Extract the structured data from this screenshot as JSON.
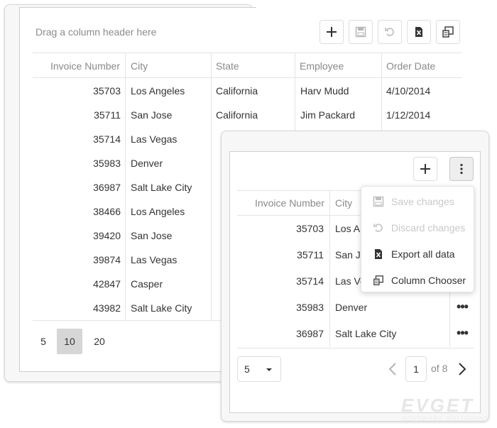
{
  "back_grid": {
    "group_panel_text": "Drag a column header here",
    "columns": [
      "Invoice Number",
      "City",
      "State",
      "Employee",
      "Order Date"
    ],
    "rows": [
      {
        "invoice": "35703",
        "city": "Los Angeles",
        "state": "California",
        "employee": "Harv Mudd",
        "date": "4/10/2014"
      },
      {
        "invoice": "35711",
        "city": "San Jose",
        "state": "California",
        "employee": "Jim Packard",
        "date": "1/12/2014"
      },
      {
        "invoice": "35714",
        "city": "Las Vegas"
      },
      {
        "invoice": "35983",
        "city": "Denver"
      },
      {
        "invoice": "36987",
        "city": "Salt Lake City"
      },
      {
        "invoice": "38466",
        "city": "Los Angeles"
      },
      {
        "invoice": "39420",
        "city": "San Jose"
      },
      {
        "invoice": "39874",
        "city": "Las Vegas"
      },
      {
        "invoice": "42847",
        "city": "Casper"
      },
      {
        "invoice": "43982",
        "city": "Salt Lake City"
      }
    ],
    "page_sizes": [
      "5",
      "10",
      "20"
    ],
    "active_page_size": "10",
    "toolbar_icons": [
      "add-icon",
      "save-icon",
      "undo-icon",
      "excel-export-icon",
      "column-chooser-icon"
    ]
  },
  "front_grid": {
    "columns": [
      "Invoice Number",
      "City"
    ],
    "rows": [
      {
        "invoice": "35703",
        "city": "Los An"
      },
      {
        "invoice": "35711",
        "city": "San Jo"
      },
      {
        "invoice": "35714",
        "city": "Las Ve"
      },
      {
        "invoice": "35983",
        "city": "Denver"
      },
      {
        "invoice": "36987",
        "city": "Salt Lake City"
      }
    ],
    "row_action_glyph": "•••",
    "toolbar_icons": [
      "add-icon",
      "more-vertical-icon"
    ],
    "menu": [
      {
        "label": "Save changes",
        "icon": "save-icon",
        "disabled": true
      },
      {
        "label": "Discard changes",
        "icon": "undo-icon",
        "disabled": true
      },
      {
        "label": "Export all data",
        "icon": "excel-export-icon",
        "disabled": false
      },
      {
        "label": "Column Chooser",
        "icon": "column-chooser-icon",
        "disabled": false
      }
    ],
    "pager": {
      "page_size": "5",
      "current_page": "1",
      "of_label": "of",
      "page_count": "8"
    }
  },
  "watermark": {
    "text": "EVGET",
    "subtext": "SOFTWARE SOLUTIONS"
  },
  "colors": {
    "border": "#e4e4e4",
    "header_text": "#8a8a8a",
    "active_page_bg": "#d6d6d6",
    "disabled_text": "#c9c9c9"
  }
}
